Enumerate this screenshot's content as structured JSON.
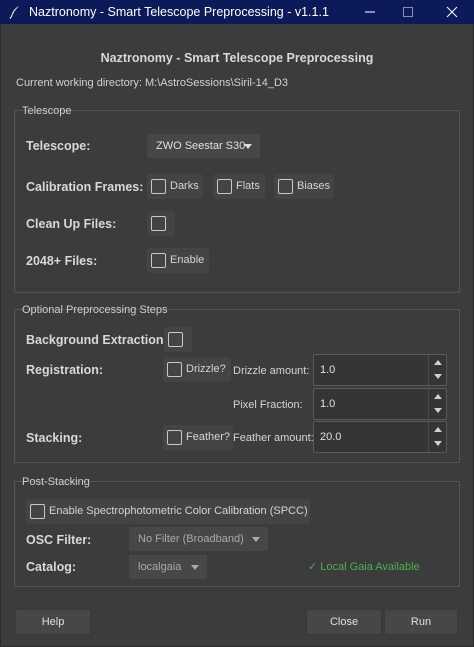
{
  "window": {
    "title": "Naztronomy - Smart Telescope Preprocessing - v1.1.1",
    "icon": "feather-pen-icon"
  },
  "header": {
    "title": "Naztronomy - Smart Telescope Preprocessing",
    "cwd": "Current working directory: M:\\AstroSessions\\Siril-14_D3"
  },
  "telescope_group": {
    "title": "Telescope",
    "telescope_label": "Telescope:",
    "telescope_value": "ZWO Seestar S30",
    "calibration_label": "Calibration Frames:",
    "darks": "Darks",
    "flats": "Flats",
    "biases": "Biases",
    "cleanup_label": "Clean Up Files:",
    "files2048_label": "2048+ Files:",
    "enable": "Enable"
  },
  "optional_group": {
    "title": "Optional Preprocessing Steps",
    "bg_label": "Background Extraction:",
    "registration_label": "Registration:",
    "drizzle": "Drizzle?",
    "drizzle_amount_label": "Drizzle amount:",
    "drizzle_amount": "1.0",
    "pixel_fraction_label": "Pixel Fraction:",
    "pixel_fraction": "1.0",
    "stacking_label": "Stacking:",
    "feather": "Feather?",
    "feather_amount_label": "Feather amount:",
    "feather_amount": "20.0"
  },
  "post_group": {
    "title": "Post-Stacking",
    "spcc": "Enable Spectrophotometric Color Calibration (SPCC)",
    "osc_label": "OSC Filter:",
    "osc_value": "No Filter (Broadband)",
    "catalog_label": "Catalog:",
    "catalog_value": "localgaia",
    "status": "Local Gaia Available",
    "status_color": "#4caf50"
  },
  "footer": {
    "help": "Help",
    "close": "Close",
    "run": "Run"
  },
  "colors": {
    "titlebar": "#0d1a5a",
    "background": "#3c3c3c"
  }
}
